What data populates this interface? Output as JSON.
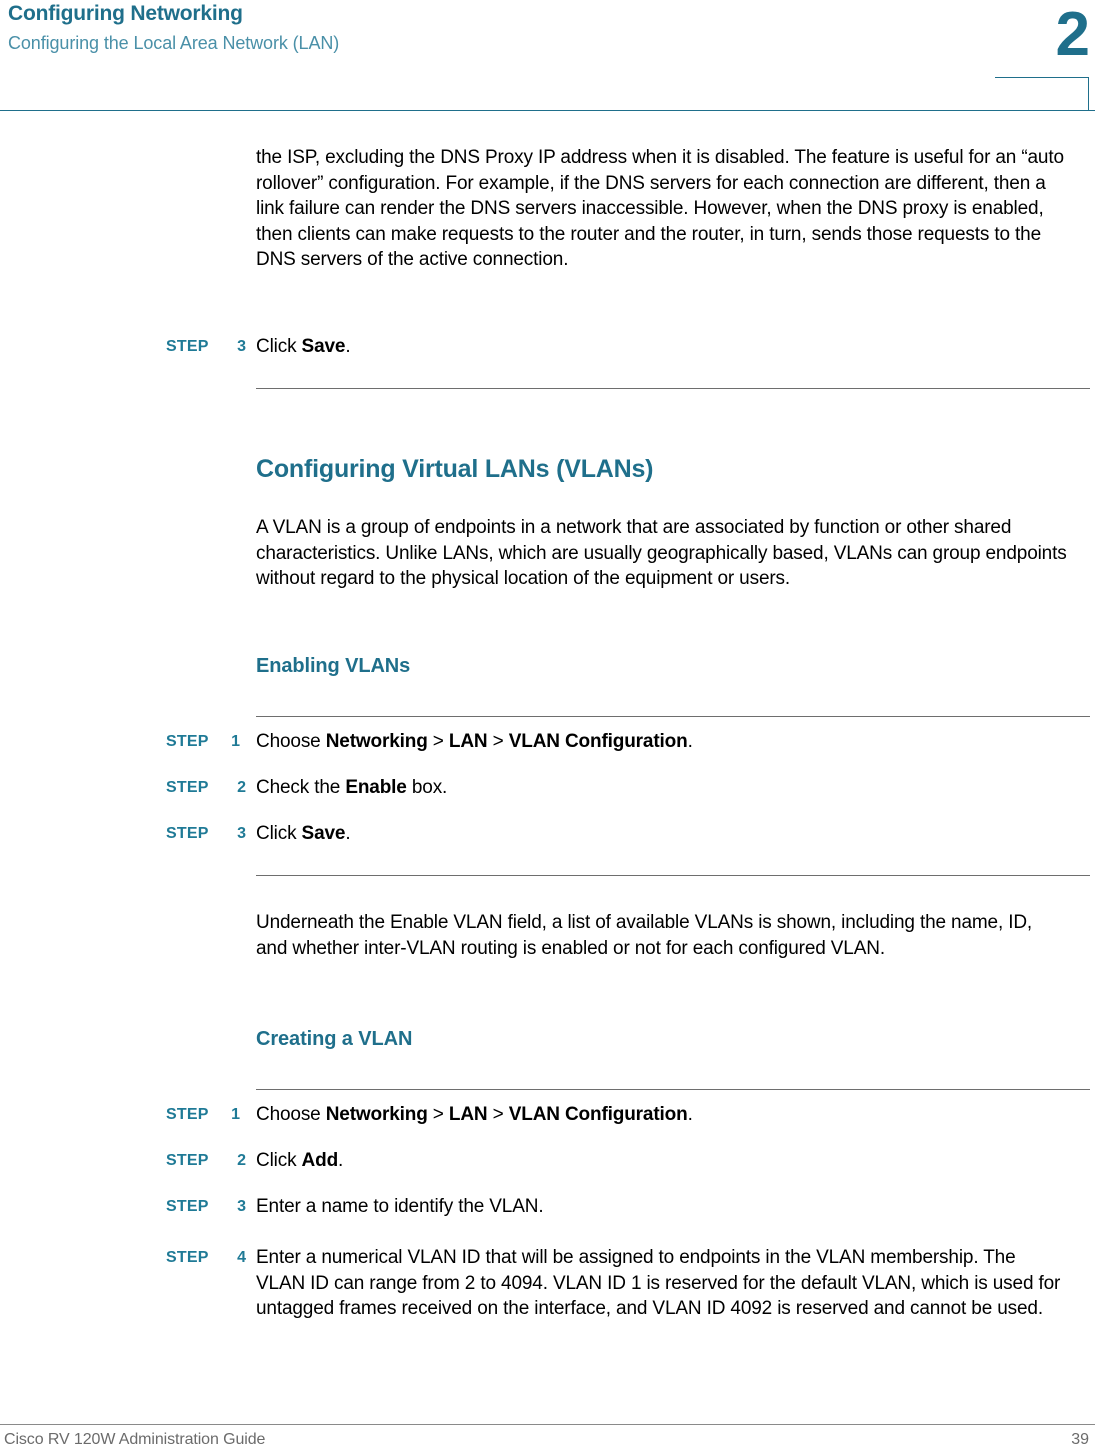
{
  "header": {
    "title": "Configuring Networking",
    "subtitle": "Configuring the Local Area Network (LAN)",
    "chapter_number": "2",
    "accent_color": "#1F6F8B",
    "subtitle_color": "#4A90A8"
  },
  "body": {
    "intro_paragraph": "the ISP, excluding the DNS Proxy IP address when it is disabled. The feature is useful for an “auto rollover” configuration. For example, if the DNS servers for each connection are different, then a link failure can render the DNS servers inaccessible. However, when the DNS proxy is enabled, then clients can make requests to the router and the router, in turn, sends those requests to the DNS servers of the active connection.",
    "step_save": {
      "label": "STEP",
      "number": "3",
      "text_before": "Click ",
      "bold": "Save",
      "text_after": "."
    },
    "section_heading": "Configuring Virtual LANs (VLANs)",
    "vlan_paragraph": "A VLAN is a group of endpoints in a network that are associated by function or other shared characteristics. Unlike LANs, which are usually geographically based, VLANs can group endpoints without regard to the physical location of the equipment or users.",
    "enabling_vlans_heading": "Enabling VLANs",
    "enabling_steps": [
      {
        "label": "STEP",
        "number": "1",
        "text_before": "Choose ",
        "bold1": "Networking",
        "sep1": " > ",
        "bold2": "LAN",
        "sep2": " > ",
        "bold3": "VLAN Configuration",
        "text_after": "."
      },
      {
        "label": "STEP",
        "number": "2",
        "text_before": "Check the ",
        "bold1": "Enable",
        "text_after": " box."
      },
      {
        "label": "STEP",
        "number": "3",
        "text_before": "Click ",
        "bold1": "Save",
        "text_after": "."
      }
    ],
    "underneath_paragraph": "Underneath the Enable VLAN field, a list of available VLANs is shown, including the name, ID, and whether inter-VLAN routing is enabled or not for each configured VLAN.",
    "creating_vlan_heading": "Creating a VLAN",
    "creating_steps": [
      {
        "label": "STEP",
        "number": "1",
        "text_before": "Choose ",
        "bold1": "Networking",
        "sep1": " > ",
        "bold2": "LAN",
        "sep2": " > ",
        "bold3": "VLAN Configuration",
        "text_after": "."
      },
      {
        "label": "STEP",
        "number": "2",
        "text_before": "Click ",
        "bold1": "Add",
        "text_after": "."
      },
      {
        "label": "STEP",
        "number": "3",
        "text_before": "Enter a name to identify the VLAN.",
        "bold1": "",
        "text_after": ""
      },
      {
        "label": "STEP",
        "number": "4",
        "text_before": "Enter a numerical VLAN ID that will be assigned to endpoints in the VLAN membership. The VLAN ID can range from 2 to 4094. VLAN ID 1 is reserved for the default VLAN, which is used for untagged frames received on the interface, and VLAN ID 4092 is reserved and cannot be used.",
        "bold1": "",
        "text_after": ""
      }
    ]
  },
  "footer": {
    "guide_title": "Cisco RV 120W Administration Guide",
    "page_number": "39"
  }
}
